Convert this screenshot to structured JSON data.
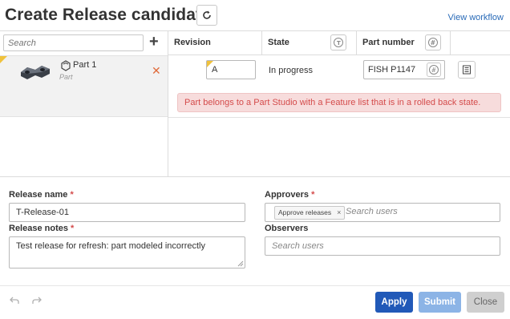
{
  "header": {
    "title": "Create Release candidate",
    "view_workflow": "View workflow"
  },
  "left_panel": {
    "search_placeholder": "Search",
    "add_icon": "plus-icon",
    "part": {
      "name": "Part 1",
      "type": "Part"
    }
  },
  "columns": {
    "revision": "Revision",
    "state": "State",
    "part_number": "Part number"
  },
  "row": {
    "revision": "A",
    "state": "In progress",
    "part_number": "FISH P1147",
    "error": "Part belongs to a Part Studio with a Feature list that is in a rolled back state."
  },
  "form": {
    "release_name_label": "Release name",
    "release_name_value": "T-Release-01",
    "release_notes_label": "Release notes",
    "release_notes_value": "Test release for refresh: part modeled incorrectly",
    "approvers_label": "Approvers",
    "approver_chip": "Approve releases",
    "approvers_placeholder": "Search users",
    "observers_label": "Observers",
    "observers_placeholder": "Search users",
    "required_marker": "*"
  },
  "footer": {
    "apply": "Apply",
    "submit": "Submit",
    "close": "Close"
  },
  "colors": {
    "primary": "#2159b8",
    "primary_disabled": "#8cb4e6",
    "error_text": "#d44b4b",
    "error_bg": "#f7dcdc",
    "warning_flag": "#f0c23c",
    "link": "#2a6bb8"
  }
}
